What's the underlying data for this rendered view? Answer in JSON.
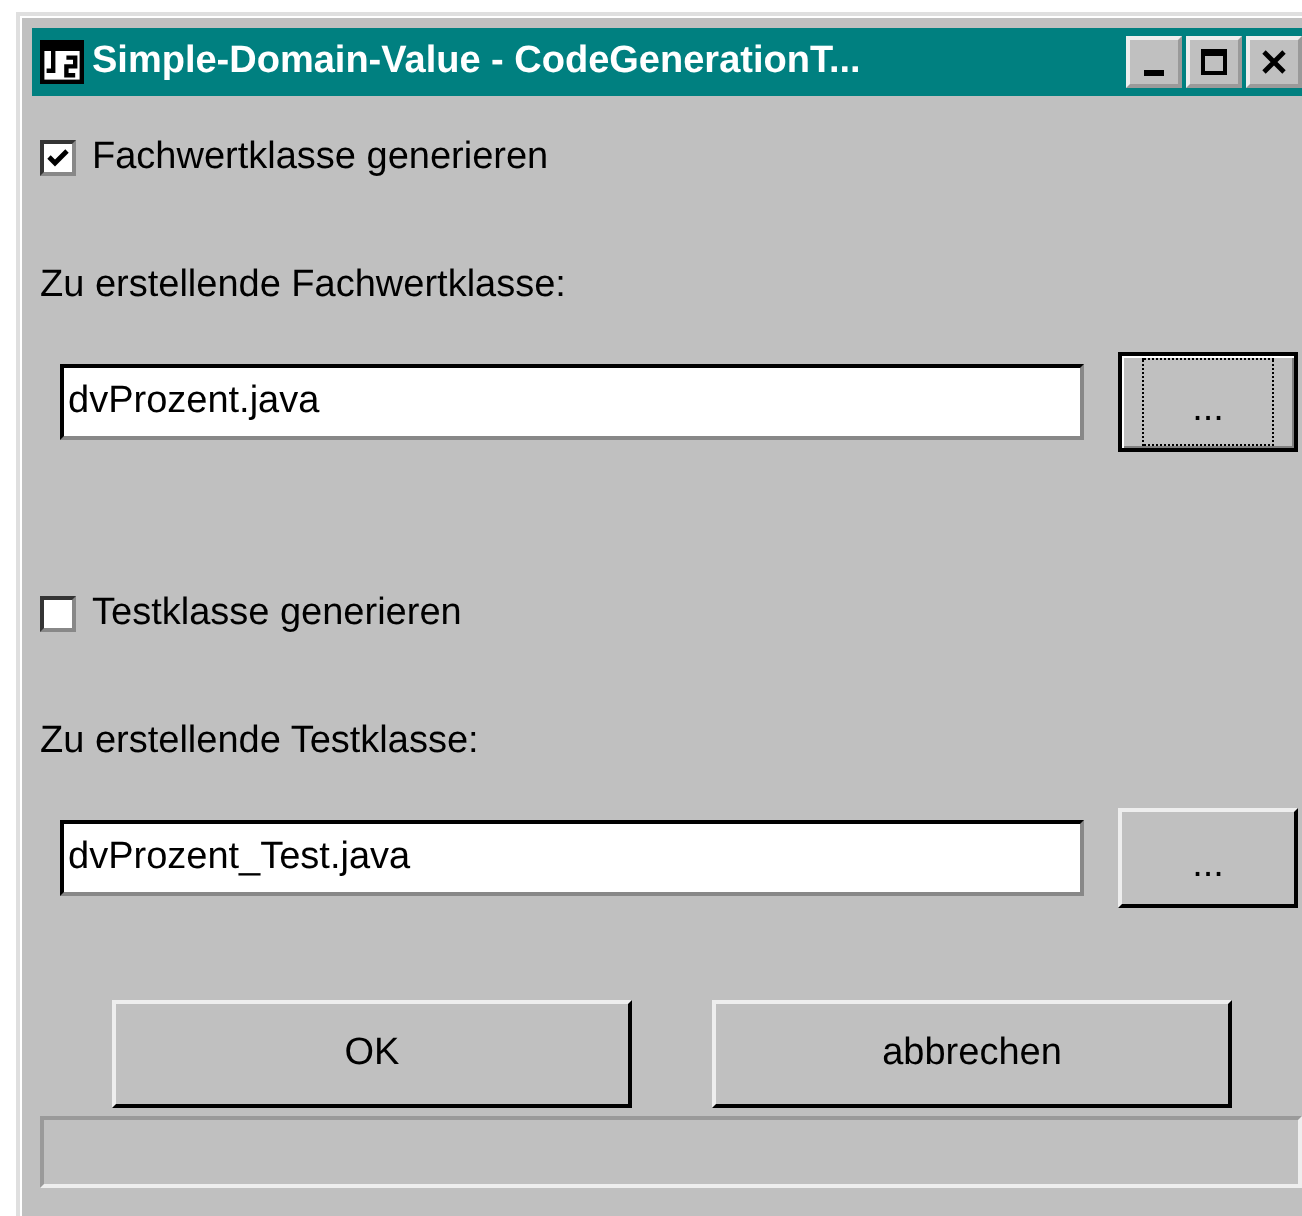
{
  "window": {
    "title": "Simple-Domain-Value - CodeGenerationT..."
  },
  "sections": [
    {
      "checkbox": {
        "label": "Fachwertklasse generieren",
        "checked": true
      },
      "field_label": "Zu erstellende Fachwertklasse:",
      "field": {
        "value": "dvProzent.java"
      },
      "browse_button": {
        "label": "...",
        "focused": true
      }
    },
    {
      "checkbox": {
        "label": "Testklasse generieren",
        "checked": false
      },
      "field_label": "Zu erstellende Testklasse:",
      "field": {
        "value": "dvProzent_Test.java"
      },
      "browse_button": {
        "label": "...",
        "focused": false
      }
    }
  ],
  "buttons": [
    "OK",
    "abbrechen"
  ]
}
